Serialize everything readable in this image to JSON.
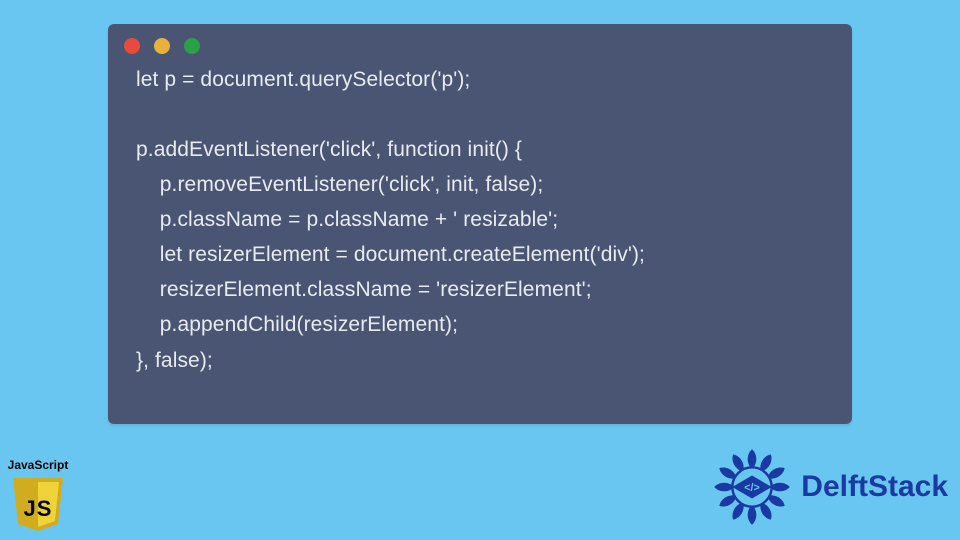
{
  "window": {
    "traffic_lights": [
      "red",
      "yellow",
      "green"
    ]
  },
  "code_lines": [
    "let p = document.querySelector('p');",
    "",
    "p.addEventListener('click', function init() {",
    "    p.removeEventListener('click', init, false);",
    "    p.className = p.className + ' resizable';",
    "    let resizerElement = document.createElement('div');",
    "    resizerElement.className = 'resizerElement';",
    "    p.appendChild(resizerElement);",
    "}, false);"
  ],
  "badge": {
    "label": "JavaScript",
    "mono": "JS"
  },
  "brand": {
    "name": "DelftStack",
    "glyph": "</>"
  },
  "colors": {
    "bg": "#68c6f0",
    "window": "#4a5573",
    "code_text": "#e8ebf0",
    "brand_blue": "#1a3aa3",
    "js_yellow_light": "#f0d33b",
    "js_yellow_dark": "#d2ac1f"
  }
}
